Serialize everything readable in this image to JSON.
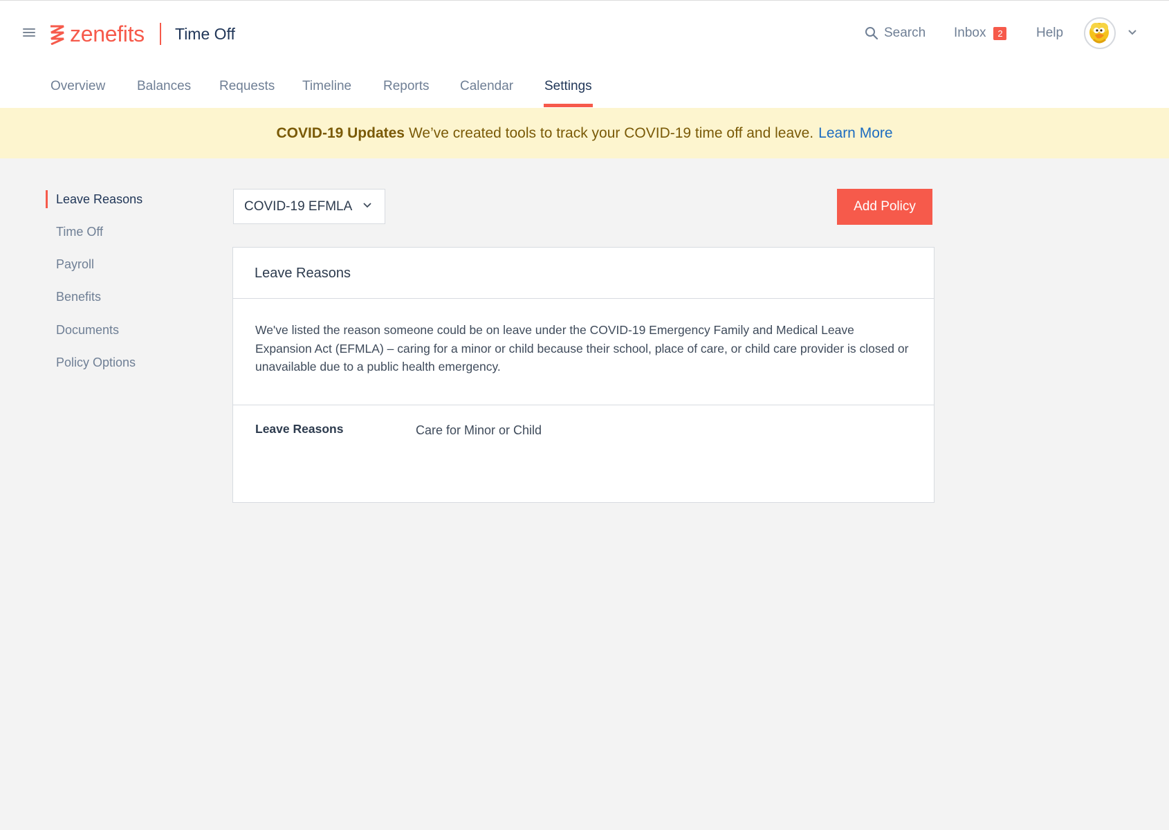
{
  "header": {
    "logo_text": "zenefits",
    "app_title": "Time Off",
    "search_label": "Search",
    "inbox_label": "Inbox",
    "inbox_count": "2",
    "help_label": "Help"
  },
  "tabs": [
    {
      "label": "Overview"
    },
    {
      "label": "Balances"
    },
    {
      "label": "Requests"
    },
    {
      "label": "Timeline"
    },
    {
      "label": "Reports"
    },
    {
      "label": "Calendar"
    },
    {
      "label": "Settings",
      "active": true
    }
  ],
  "banner": {
    "title": "COVID-19 Updates",
    "message": "We’ve created tools to track your COVID-19 time off and leave.",
    "link": "Learn More"
  },
  "sidebar": {
    "items": [
      {
        "label": "Leave Reasons",
        "active": true
      },
      {
        "label": "Time Off"
      },
      {
        "label": "Payroll"
      },
      {
        "label": "Benefits"
      },
      {
        "label": "Documents"
      },
      {
        "label": "Policy Options"
      }
    ]
  },
  "policy_select": {
    "value": "COVID-19 EFMLA"
  },
  "add_policy_label": "Add Policy",
  "card": {
    "title": "Leave Reasons",
    "description": "We've listed the reason someone could be on leave under the COVID-19 Emergency Family and Medical Leave Expansion Act (EFMLA) – caring for a minor or child because their school, place of care, or child care provider is closed or unavailable due to a public health emergency.",
    "field_label": "Leave Reasons",
    "field_value": "Care for Minor or Child"
  },
  "colors": {
    "accent": "#f65a4b",
    "banner_bg": "#fdf5cf",
    "link": "#1c6cc0",
    "nav_text": "#6f7f95",
    "page_bg": "#f3f3f3"
  }
}
